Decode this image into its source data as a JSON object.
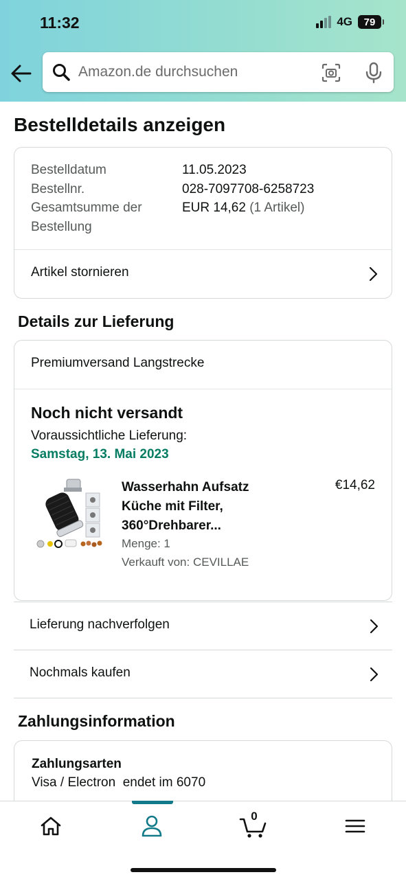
{
  "status": {
    "time": "11:32",
    "network": "4G",
    "battery": "79"
  },
  "search": {
    "placeholder": "Amazon.de durchsuchen"
  },
  "page": {
    "title": "Bestelldetails anzeigen"
  },
  "order": {
    "date_label": "Bestelldatum",
    "date_value": "11.05.2023",
    "number_label": "Bestellnr.",
    "number_value": "028-7097708-6258723",
    "total_label_1": "Gesamtsumme der",
    "total_label_2": "Bestellung",
    "total_value": "EUR 14,62",
    "total_items": "(1 Artikel)",
    "cancel_label": "Artikel stornieren"
  },
  "delivery": {
    "section_title": "Details zur Lieferung",
    "shipping_method": "Premiumversand Langstrecke",
    "status_title": "Noch nicht versandt",
    "eta_label": "Voraussichtliche Lieferung:",
    "eta_date": "Samstag, 13. Mai 2023",
    "product": {
      "title": "Wasserhahn Aufsatz Küche mit Filter, 360°Drehbarer...",
      "price": "€14,62",
      "quantity": "Menge: 1",
      "seller": "Verkauft von: CEVILLAE"
    },
    "track_label": "Lieferung nachverfolgen",
    "rebuy_label": "Nochmals kaufen"
  },
  "payment": {
    "section_title": "Zahlungsinformation",
    "methods_label": "Zahlungsarten",
    "methods_value": "Visa / Electron  endet im 6070"
  },
  "nav": {
    "cart_count": "0"
  },
  "colors": {
    "accent": "#137a8a",
    "delivery_green": "#067d62"
  }
}
